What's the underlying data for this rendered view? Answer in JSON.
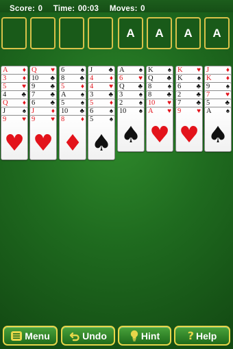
{
  "status": {
    "score_label": "Score:",
    "score": "0",
    "time_label": "Time:",
    "time": "00:03",
    "moves_label": "Moves:",
    "moves": "0"
  },
  "foundations": [
    "A",
    "A",
    "A",
    "A"
  ],
  "colors": {
    "red": "#e3131b",
    "black": "#111111",
    "felt": "#1f6b1f",
    "slot_border": "#d9c24a"
  },
  "columns": [
    [
      {
        "rank": "A",
        "suit": "♦",
        "color": "red"
      },
      {
        "rank": "3",
        "suit": "♦",
        "color": "red"
      },
      {
        "rank": "5",
        "suit": "♥",
        "color": "red"
      },
      {
        "rank": "4",
        "suit": "♣",
        "color": "black"
      },
      {
        "rank": "Q",
        "suit": "♦",
        "color": "red"
      },
      {
        "rank": "J",
        "suit": "♠",
        "color": "black"
      },
      {
        "rank": "9",
        "suit": "♥",
        "color": "red"
      }
    ],
    [
      {
        "rank": "Q",
        "suit": "♥",
        "color": "red"
      },
      {
        "rank": "10",
        "suit": "♣",
        "color": "black"
      },
      {
        "rank": "9",
        "suit": "♣",
        "color": "black"
      },
      {
        "rank": "7",
        "suit": "♣",
        "color": "black"
      },
      {
        "rank": "6",
        "suit": "♣",
        "color": "black"
      },
      {
        "rank": "J",
        "suit": "♦",
        "color": "red"
      },
      {
        "rank": "9",
        "suit": "♥",
        "color": "red"
      }
    ],
    [
      {
        "rank": "6",
        "suit": "♠",
        "color": "black"
      },
      {
        "rank": "8",
        "suit": "♣",
        "color": "black"
      },
      {
        "rank": "5",
        "suit": "♦",
        "color": "red"
      },
      {
        "rank": "A",
        "suit": "♠",
        "color": "black"
      },
      {
        "rank": "5",
        "suit": "♠",
        "color": "black"
      },
      {
        "rank": "10",
        "suit": "♣",
        "color": "black"
      },
      {
        "rank": "8",
        "suit": "♦",
        "color": "red"
      }
    ],
    [
      {
        "rank": "J",
        "suit": "♣",
        "color": "black"
      },
      {
        "rank": "4",
        "suit": "♦",
        "color": "red"
      },
      {
        "rank": "4",
        "suit": "♥",
        "color": "red"
      },
      {
        "rank": "3",
        "suit": "♣",
        "color": "black"
      },
      {
        "rank": "5",
        "suit": "♦",
        "color": "red"
      },
      {
        "rank": "6",
        "suit": "♠",
        "color": "black"
      },
      {
        "rank": "5",
        "suit": "♠",
        "color": "black"
      }
    ],
    [
      {
        "rank": "A",
        "suit": "♠",
        "color": "black"
      },
      {
        "rank": "6",
        "suit": "♥",
        "color": "red"
      },
      {
        "rank": "Q",
        "suit": "♣",
        "color": "black"
      },
      {
        "rank": "3",
        "suit": "♠",
        "color": "black"
      },
      {
        "rank": "2",
        "suit": "♠",
        "color": "black"
      },
      {
        "rank": "10",
        "suit": "♠",
        "color": "black"
      }
    ],
    [
      {
        "rank": "K",
        "suit": "♠",
        "color": "black"
      },
      {
        "rank": "Q",
        "suit": "♣",
        "color": "black"
      },
      {
        "rank": "8",
        "suit": "♠",
        "color": "black"
      },
      {
        "rank": "8",
        "suit": "♣",
        "color": "black"
      },
      {
        "rank": "10",
        "suit": "♥",
        "color": "red"
      },
      {
        "rank": "A",
        "suit": "♥",
        "color": "red"
      }
    ],
    [
      {
        "rank": "K",
        "suit": "♥",
        "color": "red"
      },
      {
        "rank": "K",
        "suit": "♠",
        "color": "black"
      },
      {
        "rank": "6",
        "suit": "♣",
        "color": "black"
      },
      {
        "rank": "2",
        "suit": "♣",
        "color": "black"
      },
      {
        "rank": "7",
        "suit": "♣",
        "color": "black"
      },
      {
        "rank": "9",
        "suit": "♥",
        "color": "red"
      }
    ],
    [
      {
        "rank": "J",
        "suit": "♦",
        "color": "red"
      },
      {
        "rank": "K",
        "suit": "♦",
        "color": "red"
      },
      {
        "rank": "9",
        "suit": "♠",
        "color": "black"
      },
      {
        "rank": "7",
        "suit": "♥",
        "color": "red"
      },
      {
        "rank": "5",
        "suit": "♣",
        "color": "black"
      },
      {
        "rank": "A",
        "suit": "♠",
        "color": "black"
      }
    ]
  ],
  "toolbar": {
    "menu_label": "Menu",
    "menu_icon": "list-icon",
    "undo_label": "Undo",
    "undo_icon": "undo-arrow-icon",
    "hint_label": "Hint",
    "hint_icon": "lightbulb-icon",
    "help_label": "Help",
    "help_icon": "question-icon"
  }
}
